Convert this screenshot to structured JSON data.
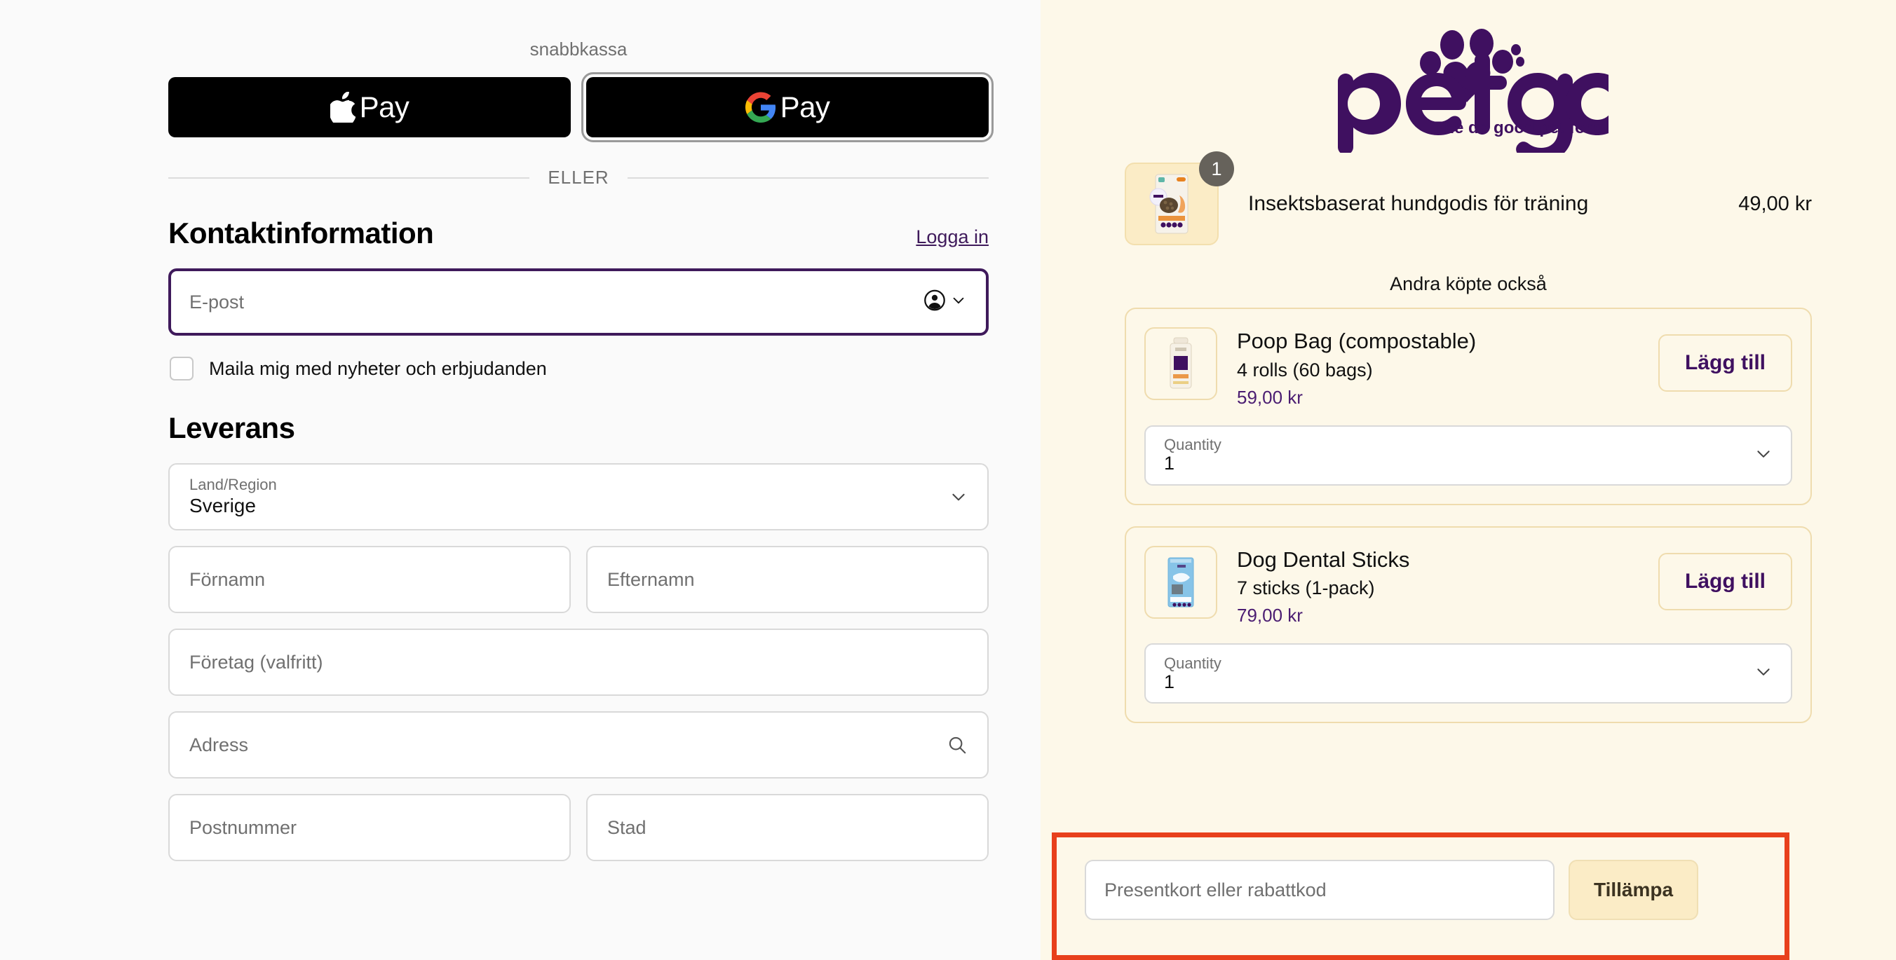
{
  "express": {
    "label": "snabbkassa",
    "apple_pay_label": "Pay",
    "google_pay_label": "Pay",
    "divider_word": "ELLER"
  },
  "contact": {
    "title": "Kontaktinformation",
    "login_link": "Logga in",
    "email_placeholder": "E-post",
    "email_value": "",
    "newsletter_label": "Maila mig med nyheter och erbjudanden",
    "newsletter_checked": false
  },
  "delivery": {
    "title": "Leverans",
    "country_label": "Land/Region",
    "country_value": "Sverige",
    "first_name_placeholder": "Förnamn",
    "last_name_placeholder": "Efternamn",
    "company_placeholder": "Företag (valfritt)",
    "address_placeholder": "Adress",
    "postal_placeholder": "Postnummer",
    "city_placeholder": "Stad"
  },
  "summary": {
    "brand_name": "petgood",
    "brand_tagline": "The do good pet food",
    "cart_item": {
      "name": "Insektsbaserat hundgodis för träning",
      "price": "49,00 kr",
      "quantity_badge": "1"
    },
    "upsell_heading": "Andra köpte också",
    "upsells": [
      {
        "title": "Poop Bag (compostable)",
        "subtitle": "4 rolls (60 bags)",
        "price": "59,00 kr",
        "add_label": "Lägg till",
        "quantity_label": "Quantity",
        "quantity_value": "1"
      },
      {
        "title": "Dog Dental Sticks",
        "subtitle": "7 sticks (1-pack)",
        "price": "79,00 kr",
        "add_label": "Lägg till",
        "quantity_label": "Quantity",
        "quantity_value": "1"
      }
    ],
    "discount": {
      "placeholder": "Presentkort eller rabattkod",
      "value": "",
      "apply_label": "Tillämpa"
    }
  },
  "colors": {
    "brand_purple": "#3f1060",
    "panel_cream": "#fdf8e9",
    "highlight_red": "#e8401c",
    "page_bg": "#fafafa"
  }
}
